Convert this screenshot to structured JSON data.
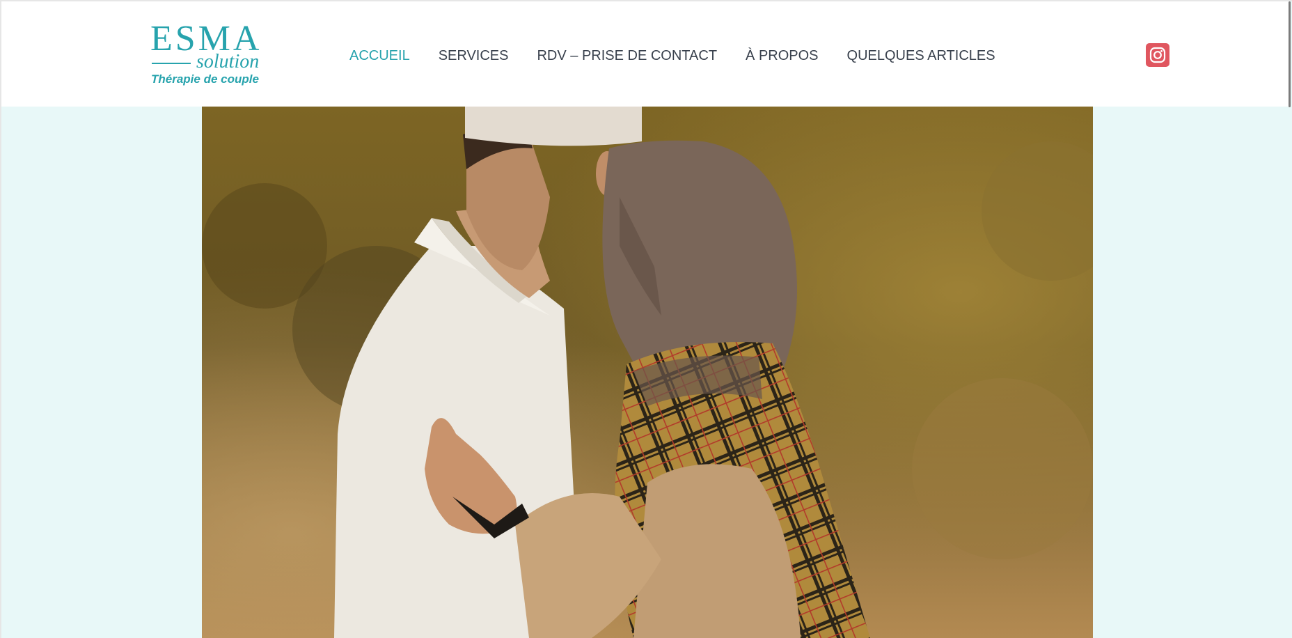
{
  "brand": {
    "name": "ESMA",
    "subname": "solution",
    "tagline": "Thérapie de couple",
    "color": "#27a3ad"
  },
  "nav": {
    "items": [
      {
        "label": "ACCUEIL",
        "active": true
      },
      {
        "label": "SERVICES",
        "active": false
      },
      {
        "label": "RDV – PRISE DE CONTACT",
        "active": false
      },
      {
        "label": "À PROPOS",
        "active": false
      },
      {
        "label": "QUELQUES ARTICLES",
        "active": false
      }
    ]
  },
  "social": {
    "icon": "instagram-icon",
    "color": "#e0565f"
  },
  "hero": {
    "image": "couple-embrace-photo",
    "background": "#e8f8f8"
  }
}
